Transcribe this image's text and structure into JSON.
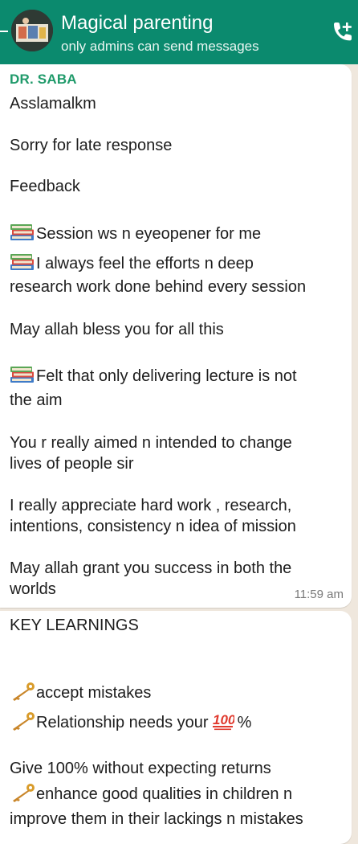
{
  "header": {
    "title": "Magical parenting",
    "subtitle": "only admins can send messages"
  },
  "messages": [
    {
      "sender": "DR. SABA",
      "lines": [
        "Asslamalkm",
        "Sorry for late response",
        "Feedback",
        "Session ws n eyeopener for me",
        "I always feel the efforts n deep",
        "research work done behind every session",
        "May allah bless you for all this",
        "Felt that only delivering lecture is not",
        "the aim",
        "You r really aimed n intended to change",
        "lives of people sir",
        "I really appreciate hard work , research,",
        "intentions, consistency n idea of mission",
        "May allah grant you success in both the",
        "worlds"
      ],
      "time": "11:59 am"
    },
    {
      "lines": [
        "KEY LEARNINGS",
        "accept mistakes",
        "Relationship needs your",
        "%",
        "Give 100% without expecting returns",
        "enhance good qualities in children n",
        "improve them in their lackings n mistakes"
      ]
    }
  ],
  "icons": {
    "books": "books-emoji",
    "key": "key-emoji",
    "hundred": "hundred-points-emoji",
    "call": "add-call-icon"
  },
  "colors": {
    "header_bg": "#0b8a6e",
    "sender": "#1f9a6a",
    "chat_bg": "#efe7dd"
  }
}
